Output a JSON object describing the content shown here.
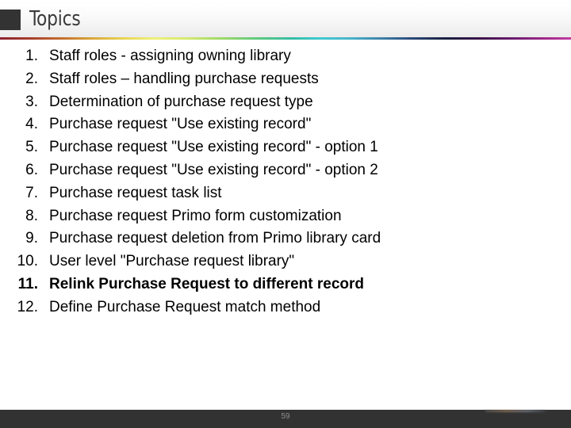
{
  "slide": {
    "header": {
      "title": "Topics",
      "square_color": "#333333",
      "title_color": "#3b3b3b"
    },
    "accent_bar": {
      "colors": [
        "#8c2230",
        "#c4702f",
        "#eef07a",
        "#5ec97e",
        "#3fc9cf",
        "#2b4a7a",
        "#1a2040",
        "#6b1c6e",
        "#c23ba2"
      ]
    },
    "topics": [
      {
        "number": "1.",
        "text": "Staff roles - assigning owning library",
        "bold": false
      },
      {
        "number": "2.",
        "text": "Staff roles – handling purchase requests",
        "bold": false
      },
      {
        "number": "3.",
        "text": "Determination of purchase request type",
        "bold": false
      },
      {
        "number": "4.",
        "text": "Purchase request \"Use existing record\"",
        "bold": false
      },
      {
        "number": "5.",
        "text": "Purchase request \"Use existing record\" - option 1",
        "bold": false
      },
      {
        "number": "6.",
        "text": "Purchase request \"Use existing record\" - option 2",
        "bold": false
      },
      {
        "number": "7.",
        "text": "Purchase request task list",
        "bold": false
      },
      {
        "number": "8.",
        "text": "Purchase request Primo form customization",
        "bold": false
      },
      {
        "number": "9.",
        "text": "Purchase request deletion from Primo library card",
        "bold": false
      },
      {
        "number": "10.",
        "text": "User level \"Purchase request library\"",
        "bold": false
      },
      {
        "number": "11.",
        "text": "Relink Purchase Request to different record",
        "bold": true
      },
      {
        "number": "12.",
        "text": "Define Purchase Request match method",
        "bold": false
      }
    ],
    "footer": {
      "page_number": "59",
      "background_color": "#323232",
      "page_number_color": "#8e8e8e"
    }
  }
}
